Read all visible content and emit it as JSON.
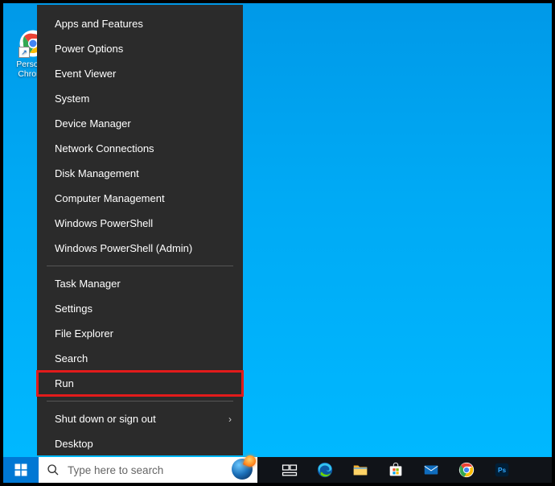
{
  "desktop": {
    "icons": [
      {
        "label_line1": "Personal",
        "label_line2": "Chrome"
      }
    ]
  },
  "winx": {
    "items": [
      {
        "label": "Apps and Features",
        "sep_before": false
      },
      {
        "label": "Power Options"
      },
      {
        "label": "Event Viewer"
      },
      {
        "label": "System"
      },
      {
        "label": "Device Manager"
      },
      {
        "label": "Network Connections"
      },
      {
        "label": "Disk Management"
      },
      {
        "label": "Computer Management"
      },
      {
        "label": "Windows PowerShell"
      },
      {
        "label": "Windows PowerShell (Admin)"
      },
      {
        "label": "Task Manager",
        "sep_before": true
      },
      {
        "label": "Settings"
      },
      {
        "label": "File Explorer"
      },
      {
        "label": "Search"
      },
      {
        "label": "Run",
        "highlight": true
      },
      {
        "label": "Shut down or sign out",
        "sep_before": true,
        "submenu": true
      },
      {
        "label": "Desktop"
      }
    ]
  },
  "taskbar": {
    "search_placeholder": "Type here to search",
    "icons": [
      {
        "name": "task-view"
      },
      {
        "name": "edge"
      },
      {
        "name": "file-explorer"
      },
      {
        "name": "microsoft-store"
      },
      {
        "name": "mail"
      },
      {
        "name": "chrome"
      },
      {
        "name": "photoshop"
      }
    ]
  }
}
